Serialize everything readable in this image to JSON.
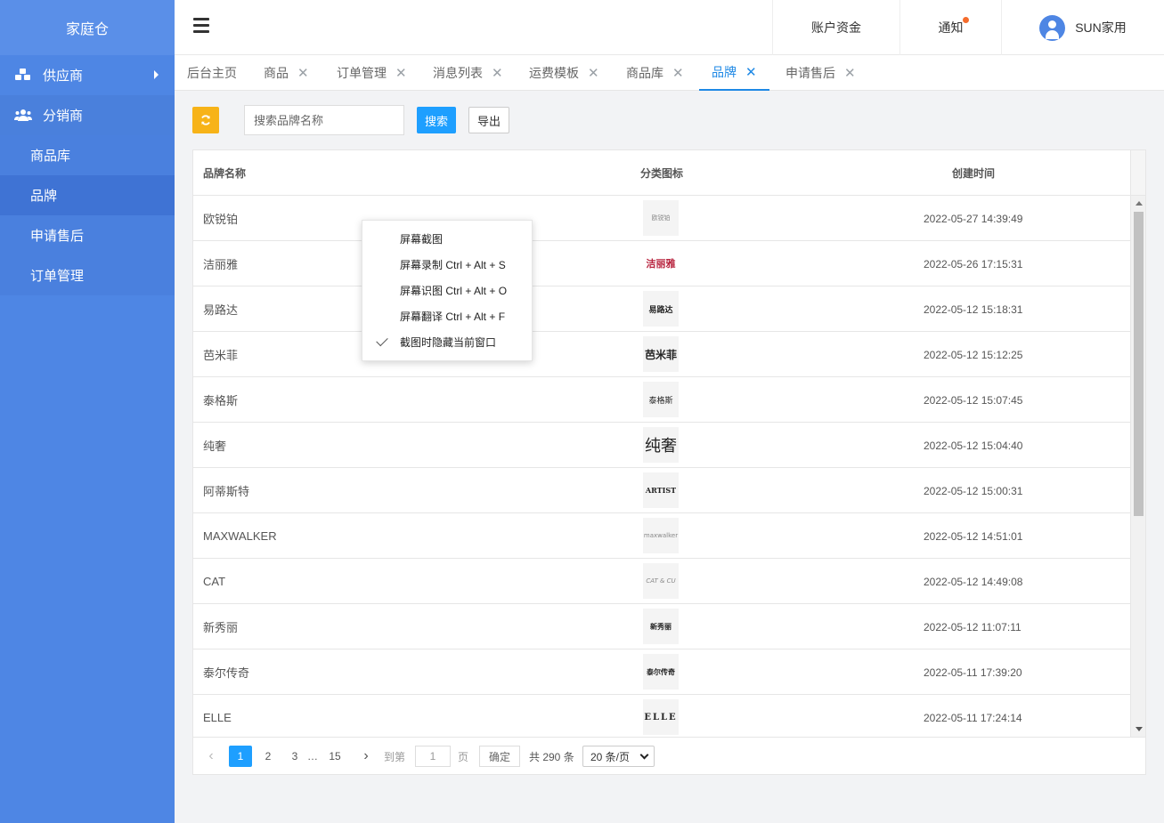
{
  "app": {
    "title": "家庭仓"
  },
  "sidebar": {
    "groups": [
      {
        "label": "供应商",
        "icon": "cubes-icon"
      },
      {
        "label": "分销商",
        "icon": "users-icon"
      }
    ],
    "items": [
      {
        "label": "商品库"
      },
      {
        "label": "品牌"
      },
      {
        "label": "申请售后"
      },
      {
        "label": "订单管理"
      }
    ]
  },
  "header": {
    "funds": "账户资金",
    "notice": "通知",
    "user": "SUN家用"
  },
  "tabs": [
    {
      "label": "后台主页"
    },
    {
      "label": "商品"
    },
    {
      "label": "订单管理"
    },
    {
      "label": "消息列表"
    },
    {
      "label": "运费模板"
    },
    {
      "label": "商品库"
    },
    {
      "label": "品牌"
    },
    {
      "label": "申请售后"
    }
  ],
  "toolbar": {
    "search_placeholder": "搜索品牌名称",
    "search_label": "搜索",
    "export_label": "导出"
  },
  "table": {
    "headers": [
      "品牌名称",
      "分类图标",
      "创建时间"
    ],
    "rows": [
      {
        "name": "欧锐铂",
        "logo": "欧锐铂",
        "time": "2022-05-27 14:39:49"
      },
      {
        "name": "洁丽雅",
        "logo": "洁丽雅",
        "time": "2022-05-26 17:15:31"
      },
      {
        "name": "易路达",
        "logo": "易路达",
        "time": "2022-05-12 15:18:31"
      },
      {
        "name": "芭米菲",
        "logo": "芭米菲",
        "time": "2022-05-12 15:12:25"
      },
      {
        "name": "泰格斯",
        "logo": "泰格斯",
        "time": "2022-05-12 15:07:45"
      },
      {
        "name": "纯奢",
        "logo": "纯奢",
        "time": "2022-05-12 15:04:40"
      },
      {
        "name": "阿蒂斯特",
        "logo": "ARTIST",
        "time": "2022-05-12 15:00:31"
      },
      {
        "name": "MAXWALKER",
        "logo": "maxwalker",
        "time": "2022-05-12 14:51:01"
      },
      {
        "name": "CAT",
        "logo": "CAT & CU",
        "time": "2022-05-12 14:49:08"
      },
      {
        "name": "新秀丽",
        "logo": "新秀丽",
        "time": "2022-05-12 11:07:11"
      },
      {
        "name": "泰尔传奇",
        "logo": "泰尔传奇",
        "time": "2022-05-11 17:39:20"
      },
      {
        "name": "ELLE",
        "logo": "ELLE",
        "time": "2022-05-11 17:24:14"
      }
    ]
  },
  "pagination": {
    "pages": [
      "1",
      "2",
      "3",
      "…",
      "15"
    ],
    "current": "1",
    "goto_label": "到第",
    "goto_value": "1",
    "page_label": "页",
    "confirm_label": "确定",
    "total": "共 290 条",
    "page_size": "20 条/页"
  },
  "context_menu": {
    "items": [
      {
        "label": "屏幕截图",
        "checked": false
      },
      {
        "label": "屏幕录制 Ctrl + Alt + S",
        "checked": false
      },
      {
        "label": "屏幕识图 Ctrl + Alt + O",
        "checked": false
      },
      {
        "label": "屏幕翻译 Ctrl + Alt + F",
        "checked": false
      },
      {
        "label": "截图时隐藏当前窗口",
        "checked": true
      }
    ]
  },
  "colors": {
    "sidebar": "#4e86e4",
    "accent": "#1e9fff",
    "refresh": "#f7b318",
    "notice_dot": "#f56c2c"
  }
}
